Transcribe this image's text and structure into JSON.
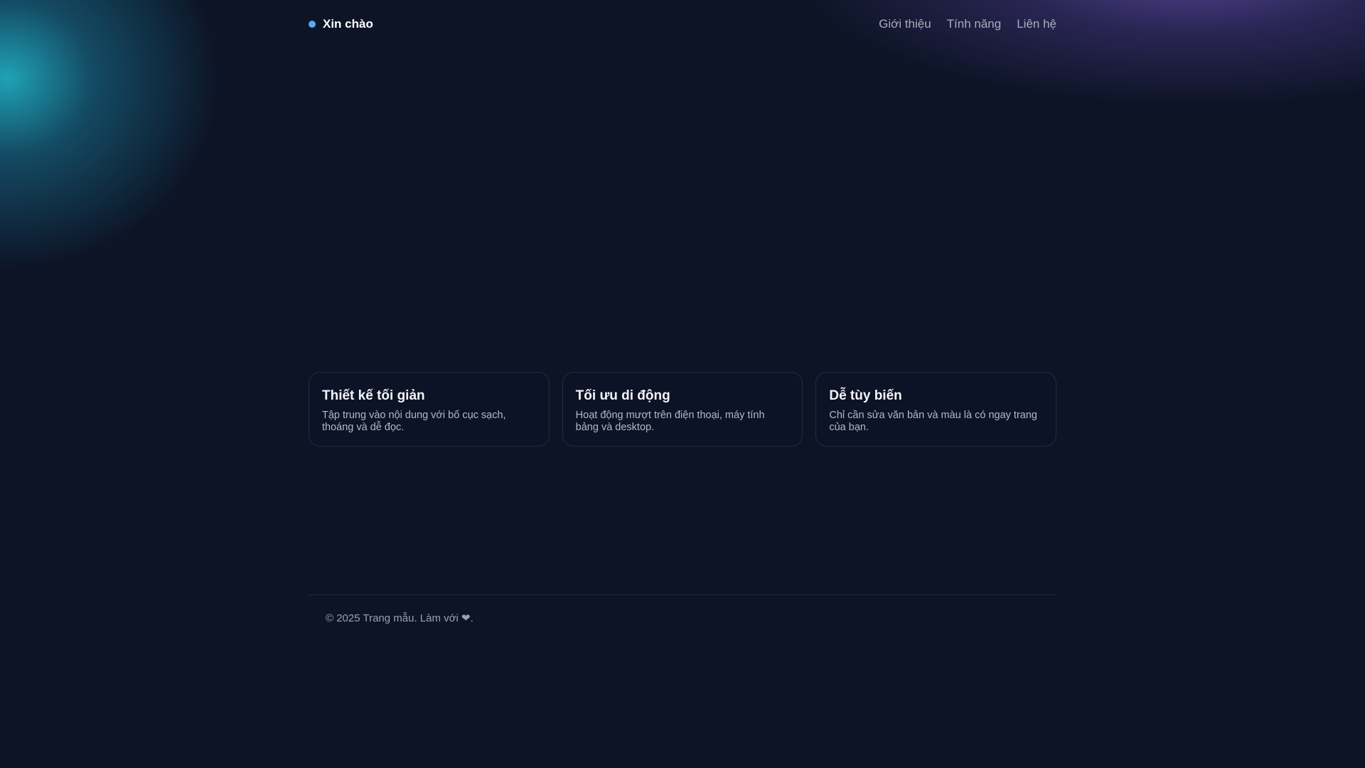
{
  "header": {
    "brand": "Xin chào",
    "nav": [
      "Giới thiệu",
      "Tính năng",
      "Liên hệ"
    ]
  },
  "features": [
    {
      "title": "Thiết kế tối giản",
      "desc": "Tập trung vào nội dung với bố cục sạch, thoáng và dễ đọc."
    },
    {
      "title": "Tối ưu di động",
      "desc": "Hoạt động mượt trên điện thoại, máy tính bảng và desktop."
    },
    {
      "title": "Dễ tùy biến",
      "desc": "Chỉ cần sửa văn bản và màu là có ngay trang của bạn."
    }
  ],
  "footer": {
    "prefix": "© 2025 Trang mẫu. Làm với",
    "heart": "❤",
    "suffix": "."
  },
  "colors": {
    "background": "#0d1426",
    "accent": "#5aa9f0"
  }
}
